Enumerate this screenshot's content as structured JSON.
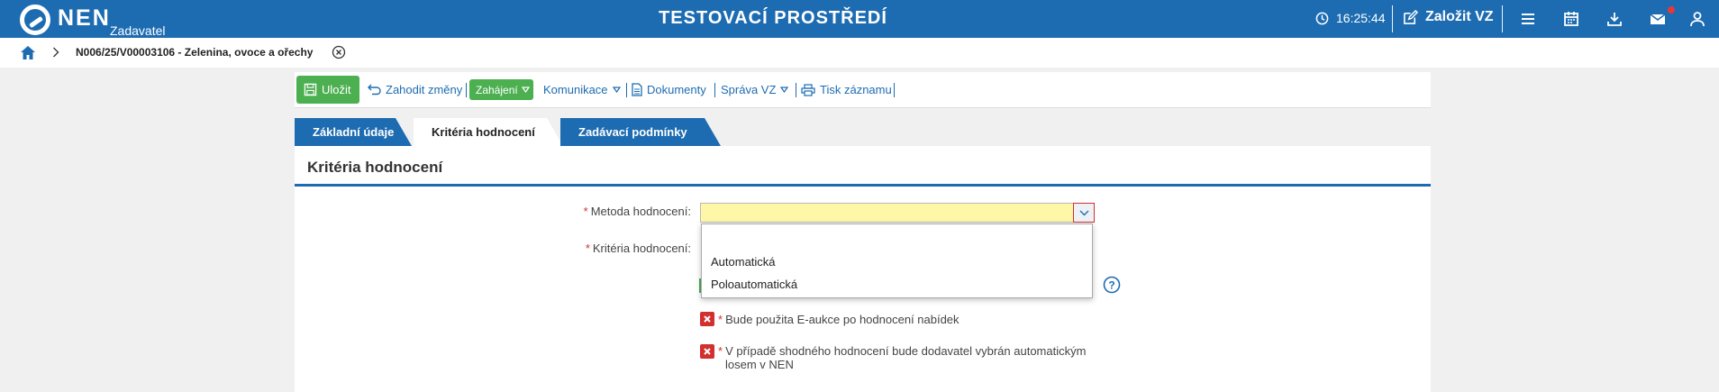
{
  "header": {
    "logo_text": "NEN",
    "logo_sub": "Zadavatel",
    "environment_title": "TESTOVACÍ PROSTŘEDÍ",
    "clock": "16:25:44",
    "create_label": "Založit VZ",
    "accent_color": "#1d6cb2",
    "icons": [
      "menu-icon",
      "calendar-icon",
      "download-icon",
      "mail-icon",
      "user-icon"
    ]
  },
  "breadcrumb": {
    "text": "N006/25/V00003106 - Zelenina, ovoce a ořechy"
  },
  "toolbar": {
    "save": "Uložit",
    "discard": "Zahodit změny",
    "start": "Zahájení",
    "communication": "Komunikace",
    "documents": "Dokumenty",
    "management": "Správa VZ",
    "print": "Tisk záznamu"
  },
  "tabs": [
    {
      "label": "Základní údaje",
      "active": false
    },
    {
      "label": "Kritéria hodnocení",
      "active": true
    },
    {
      "label": "Zadávací podmínky",
      "active": false
    }
  ],
  "panel": {
    "title": "Kritéria hodnocení"
  },
  "form": {
    "method_label": "Metoda hodnocení:",
    "criteria_label": "Kritéria hodnocení:",
    "method_value": "",
    "options": [
      "",
      "Automatická",
      "Poloautomatická"
    ],
    "checkbox_eauction": "Bude použita E-aukce po hodnocení nabídek",
    "checkbox_lottery_line1": "V případě shodného hodnocení bude dodavatel vybrán automatickým",
    "checkbox_lottery_line2": "losem v NEN"
  }
}
